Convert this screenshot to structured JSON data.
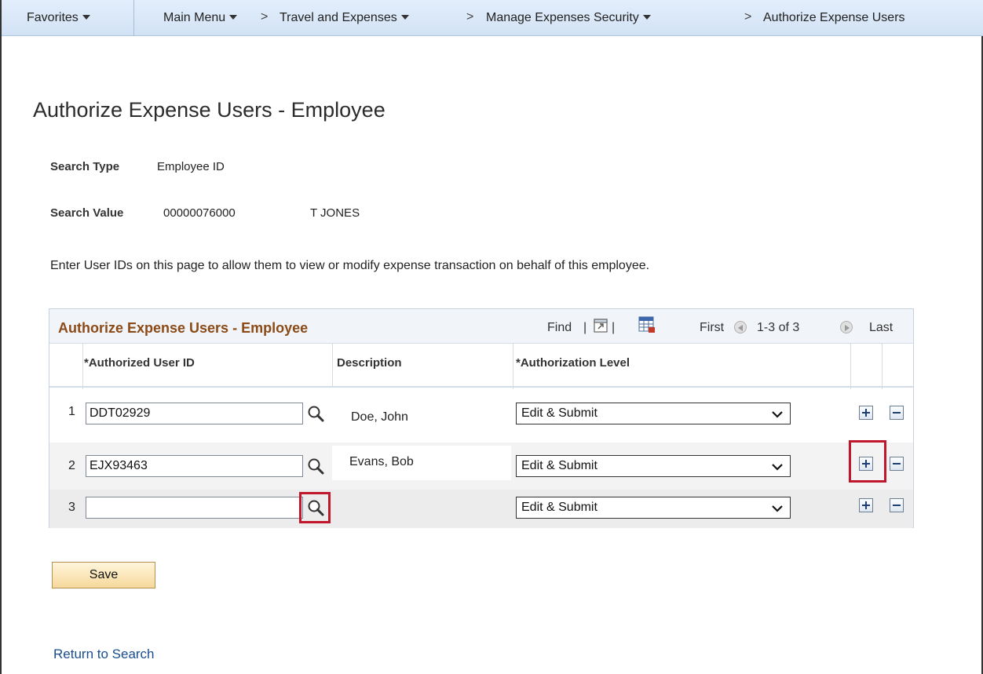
{
  "nav": {
    "favorites": "Favorites",
    "main_menu": "Main Menu",
    "chevron": ">",
    "travel": "Travel and Expenses",
    "security": "Manage Expenses Security",
    "current": "Authorize Expense Users"
  },
  "page": {
    "title": "Authorize Expense Users - Employee",
    "search_type_label": "Search Type",
    "search_type_value": "Employee ID",
    "search_value_label": "Search Value",
    "search_value_value": "00000076000",
    "employee_name": "T JONES",
    "instructions": "Enter User IDs on this page to allow them to view or modify expense transaction on behalf of this employee."
  },
  "grid": {
    "title": "Authorize Expense Users - Employee",
    "find": "Find",
    "divider": "|",
    "first": "First",
    "range": "1-3 of 3",
    "last": "Last",
    "columns": {
      "user_id": "*Authorized User ID",
      "description": "Description",
      "level": "*Authorization Level"
    },
    "rows": [
      {
        "num": "1",
        "user_id": "DDT02929",
        "description": "Doe, John",
        "level": "Edit & Submit"
      },
      {
        "num": "2",
        "user_id": "EJX93463",
        "description": "Evans, Bob",
        "level": "Edit & Submit"
      },
      {
        "num": "3",
        "user_id": "",
        "description": "",
        "level": "Edit & Submit"
      }
    ]
  },
  "actions": {
    "save": "Save",
    "return": "Return to Search"
  },
  "colors": {
    "highlight": "#c0172d",
    "grid_title": "#8b4a16",
    "link": "#1a4d8f"
  }
}
